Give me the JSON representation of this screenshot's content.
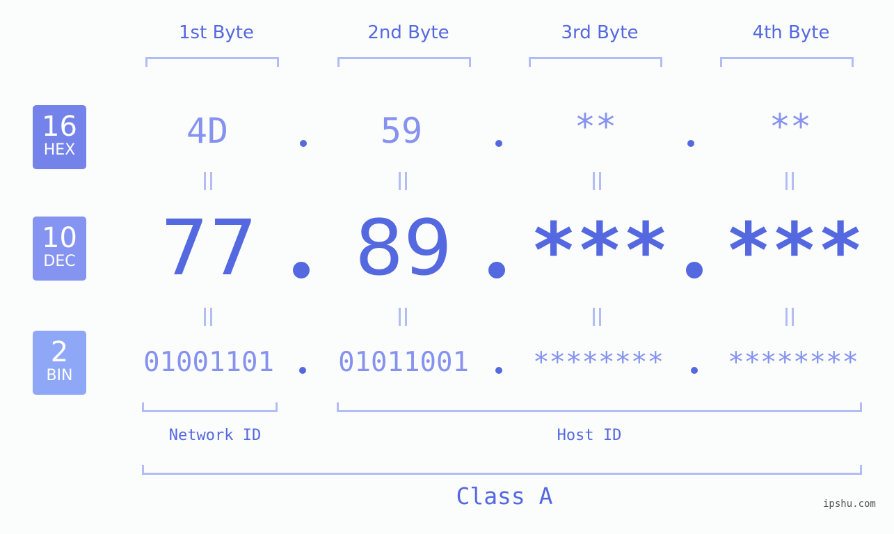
{
  "ip": "77.89.***.***",
  "bytes": [
    {
      "header": "1st Byte",
      "hex": "4D",
      "dec": "77",
      "bin": "01001101"
    },
    {
      "header": "2nd Byte",
      "hex": "59",
      "dec": "89",
      "bin": "01011001"
    },
    {
      "header": "3rd Byte",
      "hex": "**",
      "dec": "***",
      "bin": "********"
    },
    {
      "header": "4th Byte",
      "hex": "**",
      "dec": "***",
      "bin": "********"
    }
  ],
  "bases": {
    "hex": {
      "num": "16",
      "label": "HEX",
      "color": "#7383ea"
    },
    "dec": {
      "num": "10",
      "label": "DEC",
      "color": "#8594f0"
    },
    "bin": {
      "num": "2",
      "label": "BIN",
      "color": "#8fa7f7"
    }
  },
  "segments": {
    "network": "Network ID",
    "host": "Host ID"
  },
  "class_label": "Class A",
  "watermark": "ipshu.com",
  "colors": {
    "accent": "#5468e0",
    "light": "#8592ef",
    "bracket": "#b3bdf5"
  }
}
